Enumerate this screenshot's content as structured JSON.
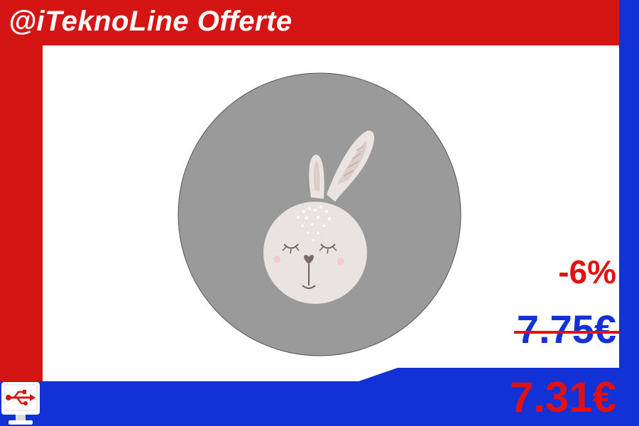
{
  "brand": {
    "title": "@iTeknoLine Offerte"
  },
  "product": {
    "image_icon": "bunny-face-icon",
    "description_visible": false
  },
  "pricing": {
    "discount": "-6%",
    "old_price": "7.75€",
    "new_price": "7.31€"
  },
  "logo": {
    "icon": "usb-monitor-icon"
  },
  "colors": {
    "brand_red": "#d51414",
    "brand_blue": "#1231d6",
    "price_red": "#e31010",
    "product_gray": "#9a9a9a"
  }
}
